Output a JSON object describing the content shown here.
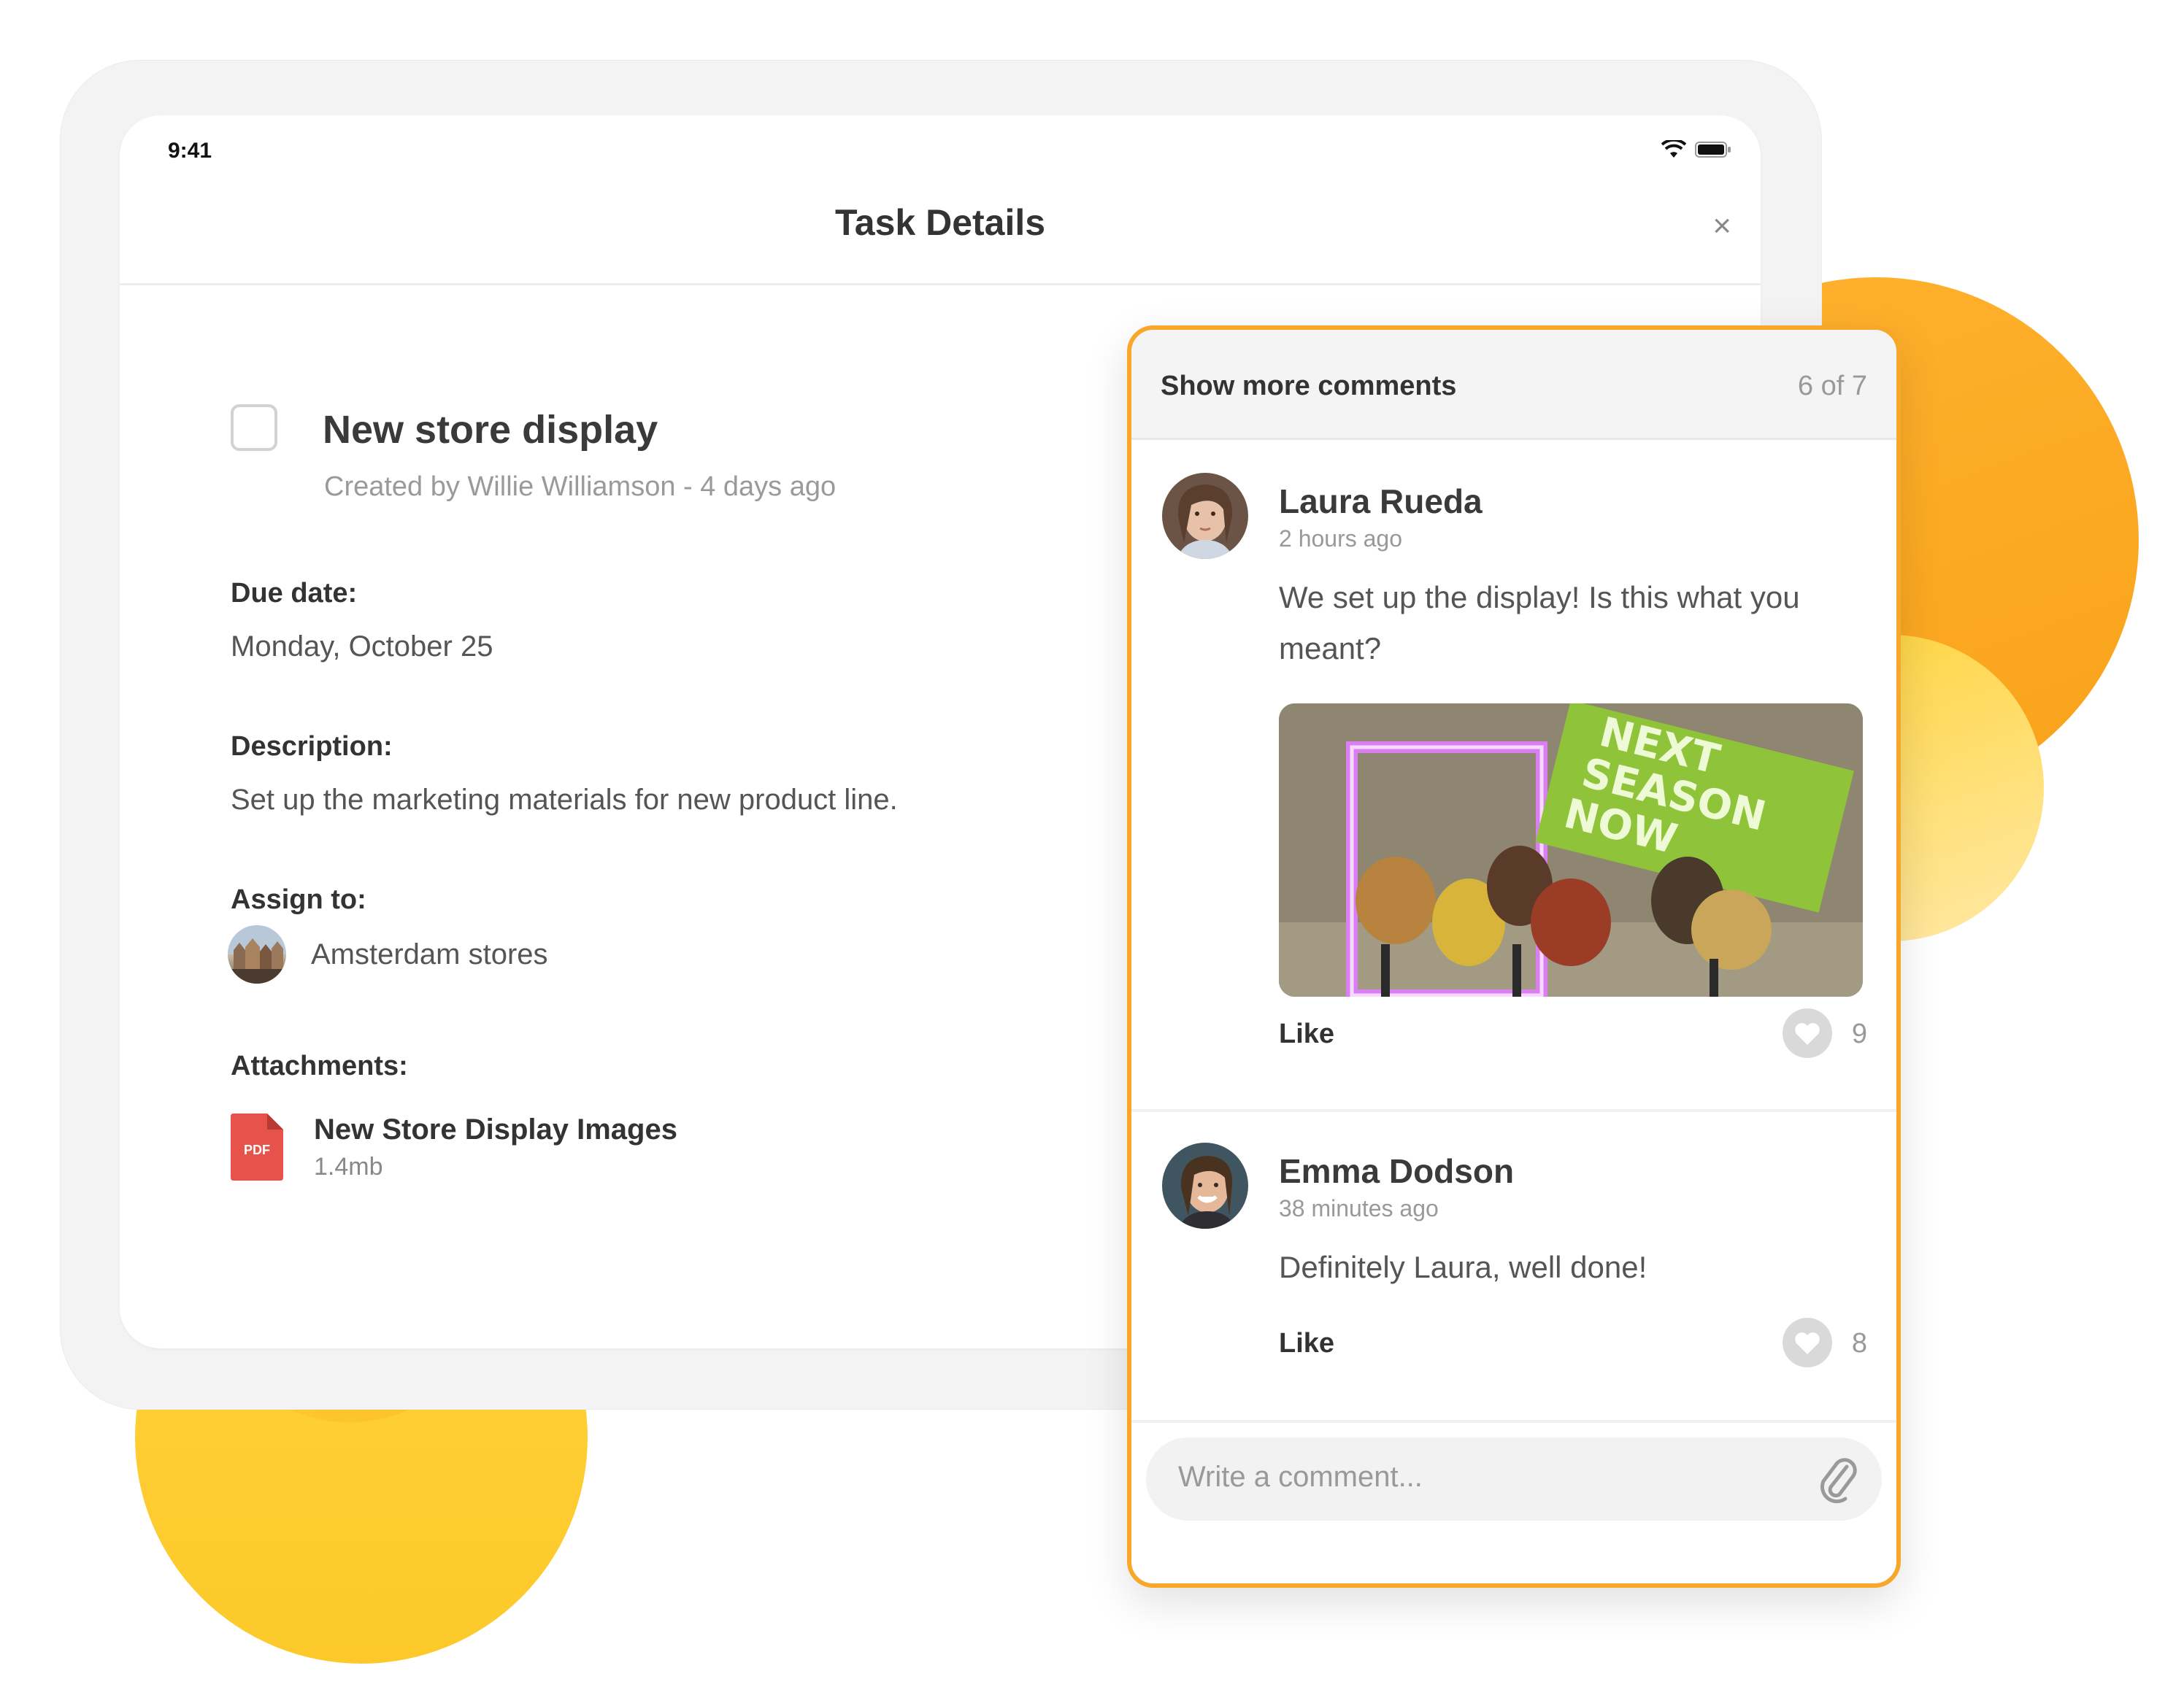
{
  "status_bar": {
    "time": "9:41"
  },
  "header": {
    "title": "Task Details",
    "close_label": "×"
  },
  "task": {
    "title": "New store display",
    "meta": "Created by Willie Williamson - 4 days ago",
    "due_label": "Due date:",
    "due_value": "Monday, October 25",
    "description_label": "Description:",
    "description_value": "Set up the marketing materials for new product line.",
    "assign_label": "Assign to:",
    "assign_value": "Amsterdam stores",
    "attachments_label": "Attachments:",
    "attachment": {
      "name": "New Store Display Images",
      "size": "1.4mb",
      "badge": "PDF"
    }
  },
  "comments": {
    "show_more": "Show more comments",
    "count": "6 of 7",
    "items": [
      {
        "author": "Laura Rueda",
        "time": "2 hours ago",
        "text": "We set up the display! Is this what you meant?",
        "photo_sign": [
          "NEXT",
          "SEASON",
          "NOW"
        ],
        "like_label": "Like",
        "likes": "9"
      },
      {
        "author": "Emma Dodson",
        "time": "38 minutes ago",
        "text": "Definitely Laura, well done!",
        "like_label": "Like",
        "likes": "8"
      }
    ],
    "input_placeholder": "Write a comment..."
  },
  "colors": {
    "accent": "#f7a72a",
    "pdf": "#e5534b"
  },
  "icons": [
    "wifi-icon",
    "battery-icon",
    "close-icon",
    "checkbox-icon",
    "pdf-icon",
    "heart-icon",
    "paperclip-icon"
  ]
}
